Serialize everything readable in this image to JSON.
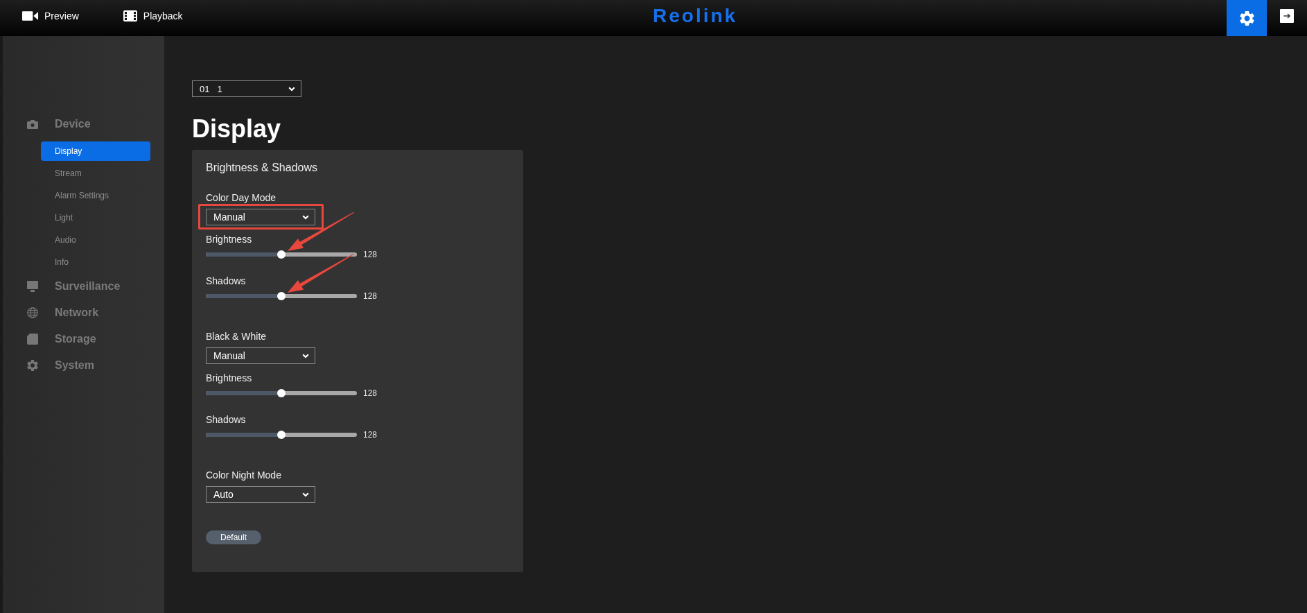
{
  "top_bar": {
    "nav": [
      {
        "label": "Preview",
        "selected": false
      },
      {
        "label": "Playback",
        "selected": false
      }
    ],
    "logo": "Reolink",
    "tool_buttons": [
      {
        "selected": true
      },
      {
        "selected": false
      }
    ]
  },
  "sidebar": {
    "groups": [
      {
        "label": "Device",
        "items": [
          {
            "label": "Display",
            "selected": true
          },
          {
            "label": "Stream",
            "selected": false
          },
          {
            "label": "Alarm Settings",
            "selected": false
          },
          {
            "label": "Light",
            "selected": false
          },
          {
            "label": "Audio",
            "selected": false
          },
          {
            "label": "Info",
            "selected": false
          }
        ]
      },
      {
        "label": "Surveillance"
      },
      {
        "label": "Network"
      },
      {
        "label": "Storage"
      },
      {
        "label": "System"
      }
    ]
  },
  "channel_select": {
    "number": "01",
    "name": "1"
  },
  "page_title": "Display",
  "panel": {
    "title": "Brightness & Shadows",
    "sections": [
      {
        "label": "Color Day Mode",
        "value": "Manual",
        "highlighted": true,
        "sliders": [
          {
            "label": "Brightness",
            "level": 0.5,
            "reading": "128",
            "annotated": true
          },
          {
            "label": "Shadows",
            "level": 0.5,
            "reading": "128",
            "annotated": true
          }
        ]
      },
      {
        "label": "Black & White",
        "value": "Manual",
        "highlighted": false,
        "sliders": [
          {
            "label": "Brightness",
            "level": 0.5,
            "reading": "128",
            "annotated": false
          },
          {
            "label": "Shadows",
            "level": 0.5,
            "reading": "128",
            "annotated": false
          }
        ]
      },
      {
        "label": "Color Night Mode",
        "value": "Auto",
        "highlighted": false
      }
    ],
    "button": "Default"
  }
}
